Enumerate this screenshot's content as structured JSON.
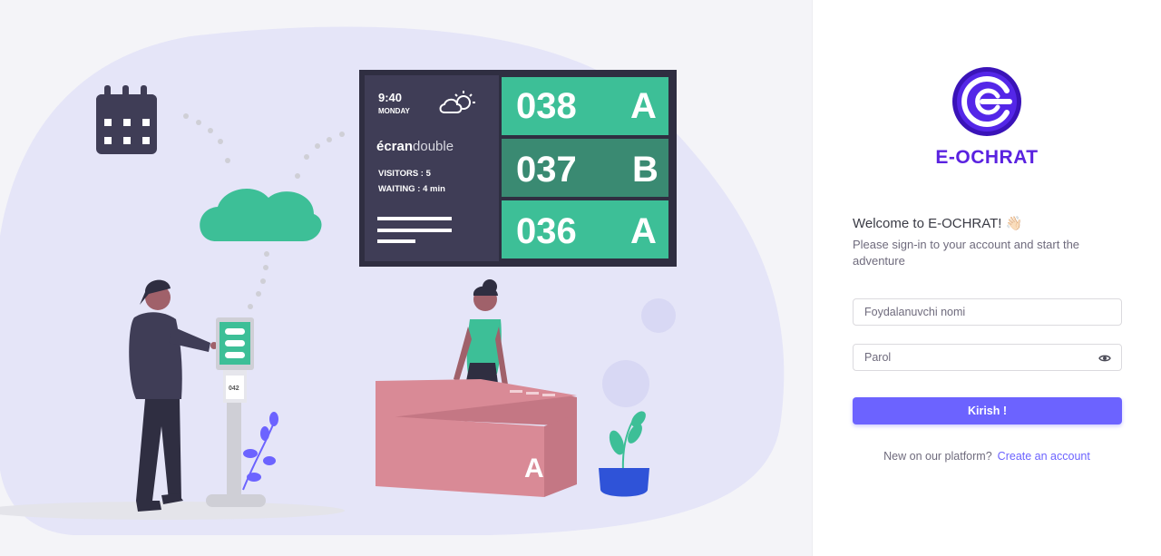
{
  "brand": {
    "name": "E-OCHRAT"
  },
  "auth": {
    "welcome": "Welcome to E-OCHRAT! 👋🏻",
    "subtitle": "Please sign-in to your account and start the adventure",
    "username_placeholder": "Foydalanuvchi nomi",
    "password_placeholder": "Parol",
    "submit_label": "Kirish !",
    "signup_prompt": "New on our platform?",
    "signup_link": "Create an account",
    "icon_password_toggle": "eye-icon"
  },
  "illustration": {
    "time": "9:40",
    "day": "MONDAY",
    "brand_bold": "écran",
    "brand_light": "double",
    "visitors": "VISITORS : 5",
    "waiting": "WAITING : 4 min",
    "tickets": [
      {
        "number": "038",
        "counter": "A"
      },
      {
        "number": "037",
        "counter": "B"
      },
      {
        "number": "036",
        "counter": "A"
      }
    ],
    "kiosk_ticket": "042",
    "desk_label": "A"
  },
  "colors": {
    "accent": "#6c63ff",
    "brand": "#5a22e0",
    "teal": "#3dbf97"
  }
}
